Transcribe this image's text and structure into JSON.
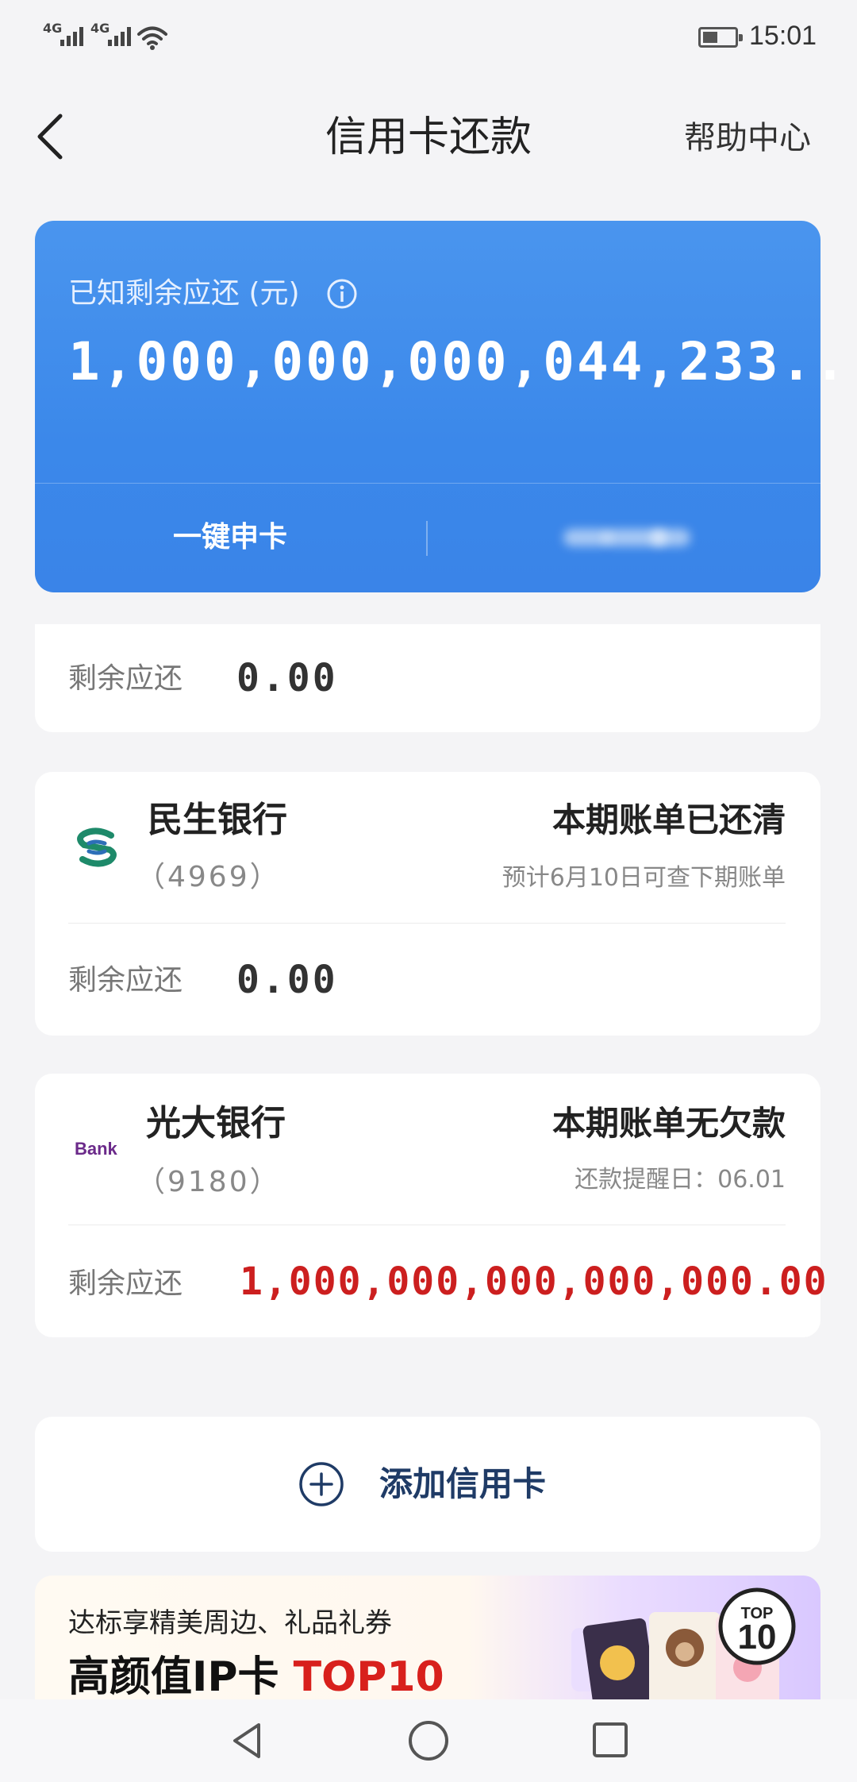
{
  "status_bar": {
    "signal1": "4G",
    "signal2": "4G",
    "time": "15:01"
  },
  "header": {
    "title": "信用卡还款",
    "help": "帮助中心"
  },
  "summary": {
    "label": "已知剩余应还 (元)",
    "amount": "1,000,000,000,044,233..",
    "apply_button": "一键申卡",
    "colors": {
      "card": "#3b88ea"
    }
  },
  "cards": [
    {
      "remaining_label": "剩余应还",
      "remaining_amount": "0.00"
    },
    {
      "bank_name": "民生银行",
      "card_number": "（4969）",
      "status": "本期账单已还清",
      "status_sub": "预计6月10日可查下期账单",
      "remaining_label": "剩余应还",
      "remaining_amount": "0.00",
      "logo": "cmbc-logo"
    },
    {
      "bank_name": "光大银行",
      "card_number": "（9180）",
      "status": "本期账单无欠款",
      "status_sub": "还款提醒日：06.01",
      "remaining_label": "剩余应还",
      "remaining_amount": "1,000,000,000,000,000.00",
      "logo_text": "Bank",
      "colors": {
        "amount": "#cc1f1f"
      }
    }
  ],
  "add_card": {
    "label": "添加信用卡"
  },
  "banner": {
    "line1": "达标享精美周边、礼品礼券",
    "line2_prefix": "高颜值IP卡 ",
    "line2_highlight": "TOP10",
    "badge_top": "TOP",
    "badge_num": "10"
  }
}
